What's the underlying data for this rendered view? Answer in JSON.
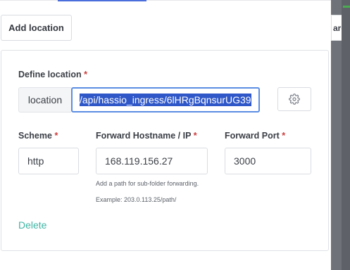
{
  "add_location_button": "Add location",
  "define_location": {
    "label": "Define location",
    "required_mark": "*",
    "prefix": "location",
    "path_value": "/api/hassio_ingress/6lHRgBqnsurUG39"
  },
  "scheme": {
    "label": "Scheme",
    "required_mark": "*",
    "value": "http"
  },
  "forward_host": {
    "label": "Forward Hostname / IP",
    "required_mark": "*",
    "value": "168.119.156.27",
    "hint_line1": "Add a path for sub-folder forwarding.",
    "hint_line2": "Example: 203.0.113.25/path/"
  },
  "forward_port": {
    "label": "Forward Port",
    "required_mark": "*",
    "value": "3000"
  },
  "delete_link": "Delete",
  "background_panel": {
    "partial_text": "ard"
  },
  "colors": {
    "accent": "#2f57c8",
    "link": "#3fb4a4",
    "required": "#cd3b3b"
  },
  "icons": {
    "settings": "gear-icon"
  }
}
